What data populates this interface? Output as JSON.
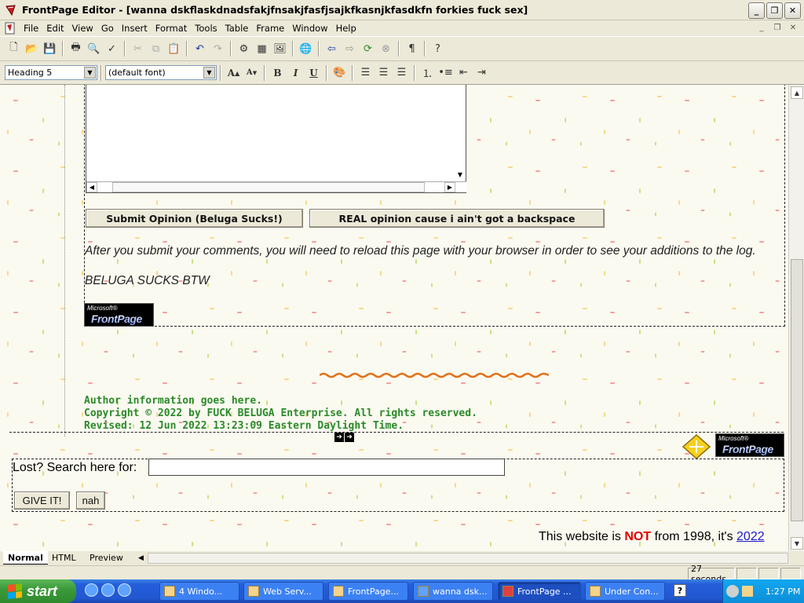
{
  "window": {
    "title": "FrontPage Editor - [wanna dskflaskdnadsfakjfnsakjfasfjsajkfkasnjkfasdkfn forkies fuck sex]",
    "controls": [
      "minimize",
      "maximize",
      "close"
    ]
  },
  "menu": [
    "File",
    "Edit",
    "View",
    "Go",
    "Insert",
    "Format",
    "Tools",
    "Table",
    "Frame",
    "Window",
    "Help"
  ],
  "format_toolbar": {
    "style_value": "Heading 5",
    "font_value": "(default font)",
    "bold": "B",
    "italic": "I",
    "underline": "U"
  },
  "page": {
    "submit_button": "Submit Opinion (Beluga Sucks!)",
    "real_button": "REAL opinion cause i ain't got a backspace",
    "reload_note": "After you submit your comments, you will need to reload this page with your browser in order to see your additions to the log.",
    "beluga_note": "BELUGA SUCKS BTW",
    "logo_ms": "Microsoft®",
    "logo_fp": "FrontPage",
    "footer": {
      "author": "Author information goes here.",
      "copyright": "Copyright © 2022 by FUCK BELUGA Enterprise. All rights reserved.",
      "revised": "Revised: 12 Jun 2022 13:23:09 Eastern Daylight Time."
    },
    "search": {
      "label": "Lost? Search here for:",
      "value": "",
      "submit": "GIVE IT!",
      "reset": "nah"
    },
    "notice": {
      "before": "This website is ",
      "not": "NOT",
      "middle": " from 1998, it's ",
      "link": "2022"
    }
  },
  "view_tabs": [
    "Normal",
    "HTML",
    "Preview"
  ],
  "status": {
    "time": "27 seconds"
  },
  "taskbar": {
    "start": "start",
    "tasks": [
      {
        "label": "4 Windo...",
        "active": false
      },
      {
        "label": "Web Serv...",
        "active": false
      },
      {
        "label": "FrontPage...",
        "active": false
      },
      {
        "label": "wanna dsk...",
        "active": false
      },
      {
        "label": "FrontPage ...",
        "active": true
      },
      {
        "label": "Under Con...",
        "active": false
      }
    ],
    "clock": "1:27 PM"
  },
  "colors": {
    "footer_green": "#2a8a2a",
    "not_red": "#e00000",
    "link_blue": "#1a1acc",
    "taskbar_blue": "#245edb"
  }
}
